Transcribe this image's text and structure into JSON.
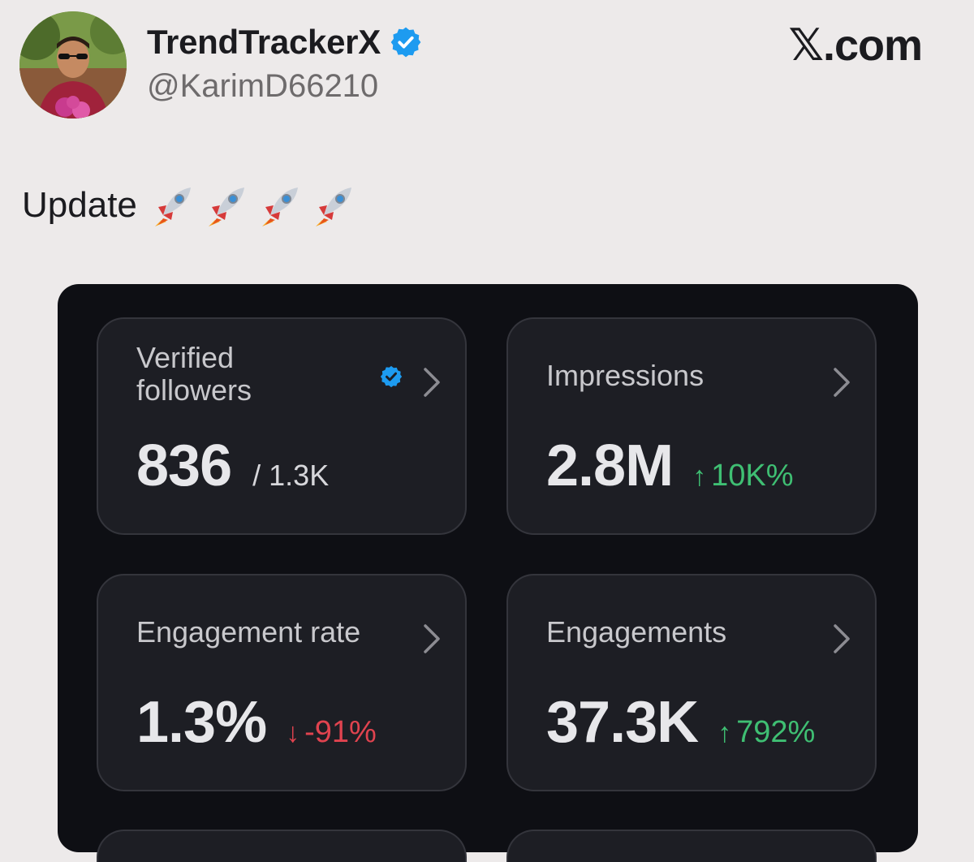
{
  "author": {
    "display_name": "TrendTrackerX",
    "handle": "@KarimD66210",
    "avatar_icon": "profile-photo",
    "verified_icon": "verified-badge-icon"
  },
  "brand": {
    "logo_text": "𝕏.com"
  },
  "post": {
    "text": "Update",
    "emoji": [
      "rocket",
      "rocket",
      "rocket",
      "rocket"
    ]
  },
  "colors": {
    "positive": "#3fbf73",
    "negative": "#e0434f",
    "verified": "#1d9bf0",
    "panel_bg": "#0e0f14",
    "card_bg": "#1d1e24"
  },
  "stats": [
    {
      "title_line1": "Verified",
      "title_line2": "followers",
      "value": "836",
      "sub": "/ 1.3K",
      "delta_arrow": "",
      "delta": ""
    },
    {
      "title": "Impressions",
      "value": "2.8M",
      "delta_arrow": "↑",
      "delta": "10K%",
      "direction": "up"
    },
    {
      "title": "Engagement rate",
      "value": "1.3%",
      "delta_arrow": "↓",
      "delta": "-91%",
      "direction": "down"
    },
    {
      "title": "Engagements",
      "value": "37.3K",
      "delta_arrow": "↑",
      "delta": "792%",
      "direction": "up"
    }
  ]
}
